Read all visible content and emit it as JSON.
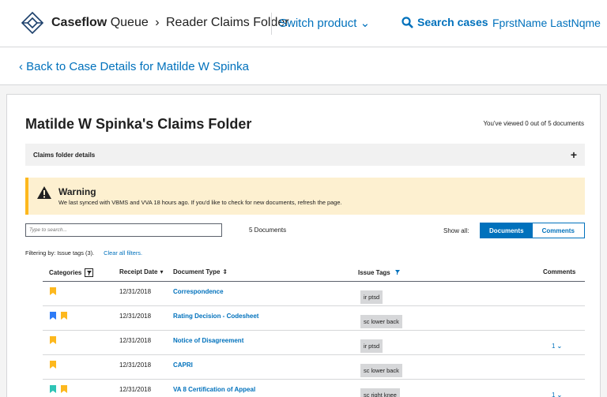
{
  "header": {
    "brand": "Caseflow",
    "app": "Queue",
    "page": "Reader Claims Folder",
    "switch_product": "Switch product",
    "search": "Search cases",
    "user": "FprstName LastNqme"
  },
  "back_link": "Back to Case Details for Matilde W Spinka",
  "folder": {
    "title": "Matilde W Spinka's Claims Folder",
    "viewed": "You've viewed 0 out of 5 documents",
    "details_label": "Claims folder details",
    "expand": "+"
  },
  "warning": {
    "title": "Warning",
    "text": "We last synced with VBMS and VVA 18 hours ago. If you'd like to check for new documents, refresh the page."
  },
  "toolbar": {
    "search_placeholder": "Type to search...",
    "count": "5 Documents",
    "show_all": "Show all:",
    "documents": "Documents",
    "comments": "Comments"
  },
  "filtering": {
    "text": "Filtering by: Issue tags (3).",
    "clear": "Clear all filters."
  },
  "table": {
    "headers": {
      "categories": "Categories",
      "receipt_date": "Receipt Date",
      "document_type": "Document Type",
      "issue_tags": "Issue Tags",
      "comments": "Comments"
    },
    "rows": [
      {
        "date": "12/31/2018",
        "type": "Correspondence",
        "tag": "ir ptsd",
        "comments": "",
        "flags": [
          "#fdb81e"
        ]
      },
      {
        "date": "12/31/2018",
        "type": "Rating Decision - Codesheet",
        "tag": "sc lower back",
        "comments": "",
        "flags": [
          "#2e7bf6",
          "#fdb81e"
        ]
      },
      {
        "date": "12/31/2018",
        "type": "Notice of Disagreement",
        "tag": "ir ptsd",
        "comments": "1",
        "flags": [
          "#fdb81e"
        ]
      },
      {
        "date": "12/31/2018",
        "type": "CAPRI",
        "tag": "sc lower back",
        "comments": "",
        "flags": [
          "#fdb81e"
        ]
      },
      {
        "date": "12/31/2018",
        "type": "VA 8 Certification of Appeal",
        "tag": "sc right knee",
        "comments": "1",
        "flags": [
          "#2ec4b6",
          "#fdb81e"
        ]
      }
    ]
  },
  "colors": {
    "accent": "#0071bc",
    "warning_bg": "#fdf0d0",
    "warning_border": "#fdb81e"
  }
}
